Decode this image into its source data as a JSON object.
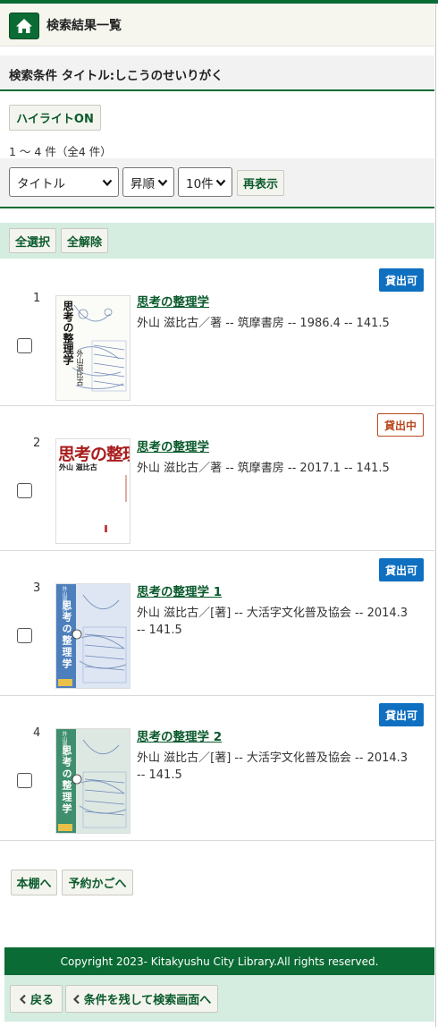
{
  "header": {
    "title": "検索結果一覧"
  },
  "conditions": {
    "text": "検索条件 タイトル:しこうのせいりがく"
  },
  "highlight_button": "ハイライトON",
  "result_count": "1 ～ 4 件（全4 件）",
  "sort": {
    "field": "タイトル",
    "order": "昇順",
    "per_page": "10件",
    "redisplay_label": "再表示"
  },
  "selection": {
    "select_all": "全選択",
    "deselect_all": "全解除"
  },
  "results": [
    {
      "number": "1",
      "title": "思考の整理学",
      "meta": "外山 滋比古／著 -- 筑摩書房 -- 1986.4 -- 141.5",
      "status": "貸出可",
      "status_type": "available",
      "cover_text": "思考の整理学",
      "cover_author": "外山滋比古"
    },
    {
      "number": "2",
      "title": "思考の整理学",
      "meta": "外山 滋比古／著 -- 筑摩書房 -- 2017.1 -- 141.5",
      "status": "貸出中",
      "status_type": "checked_out",
      "cover_text": "思考の整理学",
      "cover_author": "外山 滋比古"
    },
    {
      "number": "3",
      "title": "思考の整理学 1",
      "meta": "外山 滋比古／[著] -- 大活字文化普及協会 -- 2014.3 -- 141.5",
      "status": "貸出可",
      "status_type": "available",
      "cover_text": "思考の整理学",
      "cover_author": "外山滋比古"
    },
    {
      "number": "4",
      "title": "思考の整理学 2",
      "meta": "外山 滋比古／[著] -- 大活字文化普及協会 -- 2014.3 -- 141.5",
      "status": "貸出可",
      "status_type": "available",
      "cover_text": "思考の整理学",
      "cover_author": "外山滋比古"
    }
  ],
  "actions": {
    "bookshelf": "本棚へ",
    "reserve_cart": "予約かごへ"
  },
  "footer": {
    "copyright": "Copyright 2023- Kitakyushu City Library.All rights reserved."
  },
  "nav": {
    "back": "戻る",
    "back_keep": "条件を残して検索画面へ"
  },
  "colors": {
    "brand": "#0a6b34",
    "available": "#0f6fc0",
    "checked_out": "#b8491f",
    "light_green": "#d5ece0"
  }
}
